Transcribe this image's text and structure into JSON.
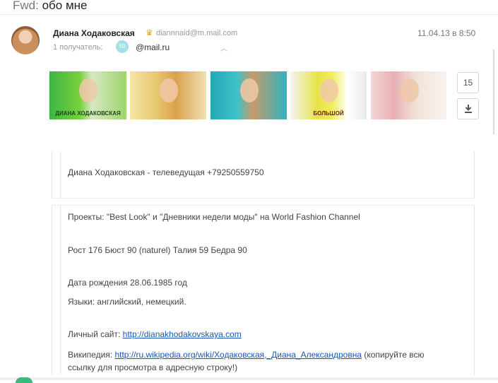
{
  "subject": {
    "prefix": "Fwd:",
    "text": "обо мне"
  },
  "sender": {
    "name": "Диана Ходаковская",
    "email": "diannnaid@m.mail.com",
    "date": "11.04.13 в 8:50"
  },
  "recipients": {
    "label": "1 получатель:",
    "avatar_text": "50",
    "address": "@mail.ru"
  },
  "attachments": {
    "count": "15",
    "thumb_texts": [
      "ДИАНА ХОДАКОВСКАЯ",
      "",
      "",
      "БОЛЬШОЙ",
      ""
    ]
  },
  "icons": {
    "crown": "crown-icon",
    "download": "download-icon",
    "chevron": "chevron-up-icon"
  },
  "body": {
    "intro": "Диана Ходаковская - телеведущая   +79250559750",
    "projects": "Проекты: \"Best Look\" и \"Дневники недели моды\" на World Fashion Channel",
    "measurements": "Рост 176  Бюст 90 (naturel)  Талия 59  Бедра 90",
    "birth": "Дата рождения 28.06.1985 год",
    "languages": "Языки: английский, немецкий.",
    "site_label": "Личный сайт:",
    "site_link": "http://dianakhodakovskaya.com",
    "wiki_label": "Википедия:",
    "wiki_link": "http://ru.wikipedia.org/wiki/Ходаковская,_Диана_Александровна",
    "wiki_note_1": "(копируйте всю",
    "wiki_note_2": "ссылку для просмотра в адресную строку!)"
  }
}
